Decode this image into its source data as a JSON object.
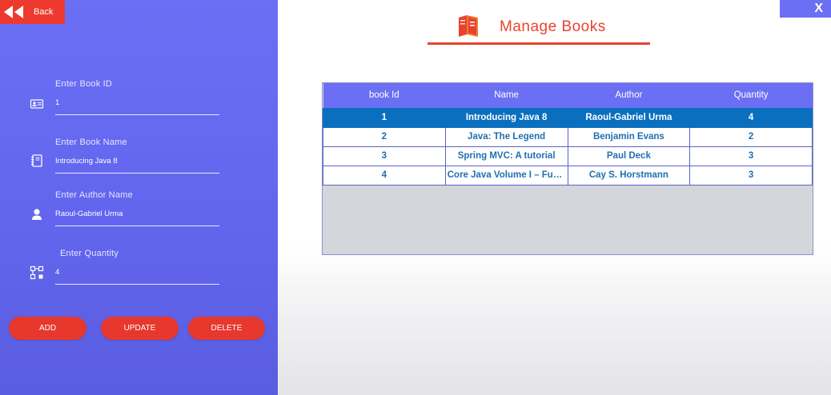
{
  "header": {
    "back_label": "Back",
    "close_label": "X",
    "title": "Manage Books"
  },
  "form": {
    "book_id": {
      "label": "Enter Book ID",
      "value": "1",
      "icon": "id-card-icon"
    },
    "book_name": {
      "label": "Enter Book Name",
      "value": "Introducing Java 8",
      "icon": "book-icon"
    },
    "author_name": {
      "label": "Enter Author Name",
      "value": "Raoul-Gabriel Urma",
      "icon": "person-icon"
    },
    "quantity": {
      "label": "Enter Quantity",
      "value": "4",
      "icon": "quantity-icon"
    }
  },
  "actions": {
    "add": "ADD",
    "update": "UPDATE",
    "delete": "DELETE"
  },
  "table": {
    "columns": [
      "book Id",
      "Name",
      "Author",
      "Quantity"
    ],
    "selected_row": 0,
    "rows": [
      [
        "1",
        "Introducing Java 8",
        "Raoul-Gabriel Urma",
        "4"
      ],
      [
        "2",
        "Java: The Legend",
        "Benjamin Evans",
        "2"
      ],
      [
        "3",
        "Spring MVC: A tutorial",
        "Paul Deck",
        "3"
      ],
      [
        "4",
        "Core Java Volume I – Fun...",
        "Cay S. Horstmann",
        "3"
      ]
    ]
  },
  "colors": {
    "panel": "#6b6ff4",
    "accent_red": "#e8372c",
    "selected_row": "#0a6fbf",
    "cell_text": "#1f6fb0"
  }
}
